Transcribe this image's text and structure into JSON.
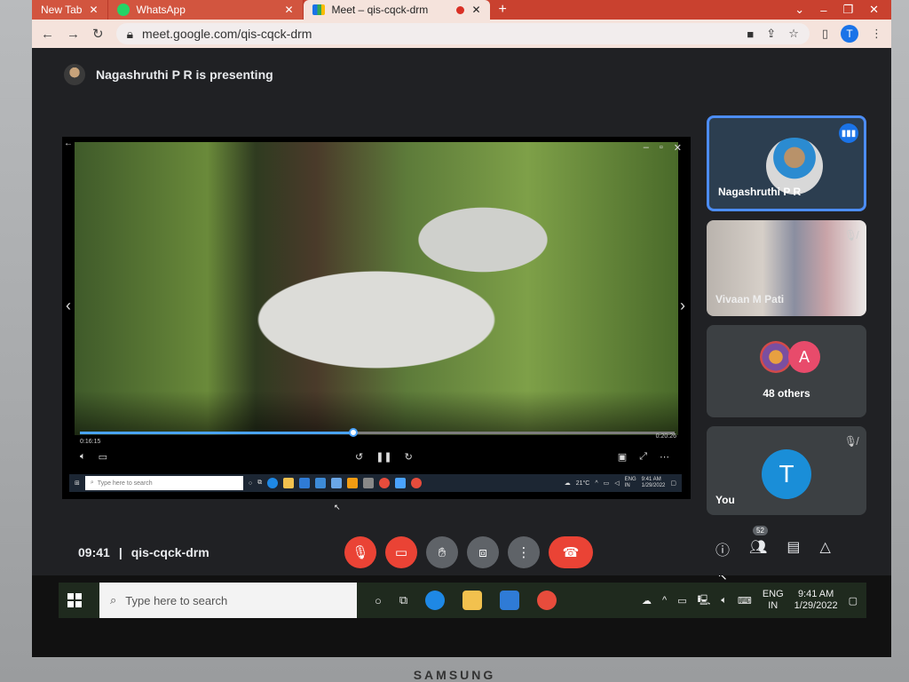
{
  "browser": {
    "tabs": [
      {
        "label": "New Tab",
        "active": false
      },
      {
        "label": "WhatsApp",
        "active": false
      },
      {
        "label": "Meet – qis-cqck-drm",
        "active": true
      }
    ],
    "new_tab": "+",
    "url": "meet.google.com/qis-cqck-drm",
    "profile_initial": "T"
  },
  "meet": {
    "presenting_text": "Nagashruthi P R is presenting",
    "player": {
      "time_current": "0:16:15",
      "time_total": "0:20:26",
      "progress_fraction": 0.46
    },
    "inner_taskbar": {
      "search_placeholder": "Type here to search",
      "weather": "21°C",
      "lang_top": "ENG",
      "lang_bottom": "IN",
      "time": "9:41 AM",
      "date": "1/29/2022"
    },
    "participants": [
      {
        "name": "Nagashruthi P R"
      },
      {
        "name": "Vivaan M Pati"
      },
      {
        "name": "48 others",
        "avatar_letter": "A"
      },
      {
        "name": "You",
        "avatar_letter": "T"
      }
    ],
    "bottom": {
      "clock": "09:41",
      "separator": "|",
      "meeting_code": "qis-cqck-drm",
      "people_count": "52"
    }
  },
  "taskbar": {
    "search_placeholder": "Type here to search",
    "lang_top": "ENG",
    "lang_bottom": "IN",
    "time": "9:41 AM",
    "date": "1/29/2022"
  },
  "monitor": {
    "brand": "SAMSUNG"
  },
  "colors": {
    "tabstrip": "#c9412f",
    "meet_bg": "#202124",
    "active_tile_border": "#4c8df6",
    "red_button": "#ea4335",
    "avatar_blue": "#1a8ed8",
    "avatar_pink": "#e84b6b"
  },
  "icons": [
    "back-arrow-icon",
    "forward-arrow-icon",
    "reload-icon",
    "lock-icon",
    "camera-icon",
    "share-icon",
    "star-icon",
    "sidebar-icon",
    "kebab-icon",
    "mic-off-icon",
    "camera-off-icon",
    "raise-hand-icon",
    "present-icon",
    "more-icon",
    "end-call-icon",
    "info-icon",
    "people-icon",
    "chat-icon",
    "activities-icon",
    "windows-logo-icon",
    "search-icon",
    "cortana-icon",
    "task-view-icon"
  ]
}
